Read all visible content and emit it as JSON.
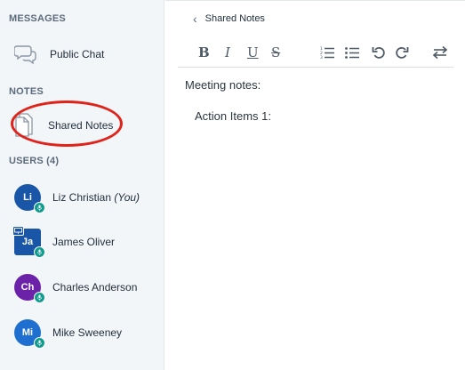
{
  "sidebar": {
    "messages_title": "MESSAGES",
    "public_chat_label": "Public Chat",
    "notes_title": "NOTES",
    "shared_notes_label": "Shared Notes",
    "users_title": "USERS (4)",
    "users": [
      {
        "initials": "Li",
        "name": "Liz Christian",
        "suffix": "(You)",
        "color": "#1a56a8",
        "shape": "circle"
      },
      {
        "initials": "Ja",
        "name": "James Oliver",
        "suffix": "",
        "color": "#1a56a8",
        "shape": "square"
      },
      {
        "initials": "Ch",
        "name": "Charles Anderson",
        "suffix": "",
        "color": "#6b21a8",
        "shape": "circle"
      },
      {
        "initials": "Mi",
        "name": "Mike Sweeney",
        "suffix": "",
        "color": "#1e6fd0",
        "shape": "circle"
      }
    ]
  },
  "notes_panel": {
    "back_label": "Shared Notes",
    "toolbar": {
      "bold": "B",
      "italic": "I",
      "underline": "U",
      "strike": "S"
    },
    "content": {
      "line1": "Meeting notes:",
      "line2": "Action Items 1:"
    }
  },
  "colors": {
    "sidebar_bg": "#f3f6f9",
    "highlight": "#e0231a",
    "mic_badge": "#139b8f"
  },
  "icons": [
    "chat-bubbles-icon",
    "notes-document-icon",
    "microphone-icon",
    "presenter-icon",
    "chevron-left-icon",
    "ordered-list-icon",
    "unordered-list-icon",
    "undo-icon",
    "redo-icon",
    "swap-icon"
  ]
}
